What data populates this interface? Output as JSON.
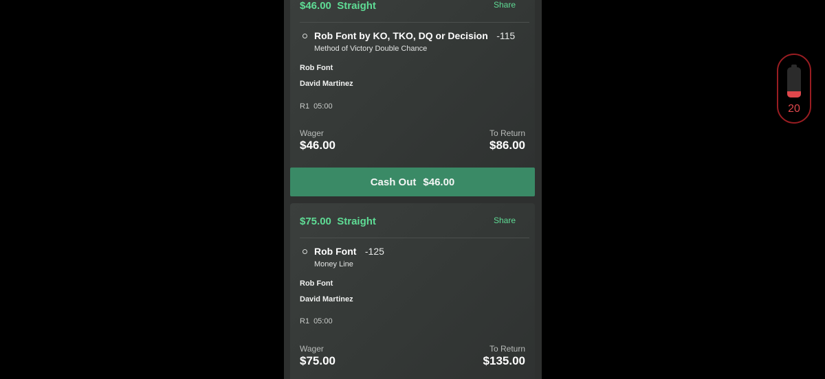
{
  "bets": [
    {
      "title_amount": "$46.00",
      "title_type": "Straight",
      "share_label": "Share",
      "selection": "Rob Font by KO, TKO, DQ or Decision",
      "odds": "-115",
      "market": "Method of Victory Double Chance",
      "fighter_1": "Rob Font",
      "fighter_2": "David Martinez",
      "round": "R1",
      "time": "05:00",
      "wager_label": "Wager",
      "wager": "$46.00",
      "return_label": "To Return",
      "to_return": "$86.00",
      "cashout_label": "Cash Out",
      "cashout_amount": "$46.00"
    },
    {
      "title_amount": "$75.00",
      "title_type": "Straight",
      "share_label": "Share",
      "selection": "Rob Font",
      "odds": "-125",
      "market": "Money Line",
      "fighter_1": "Rob Font",
      "fighter_2": "David Martinez",
      "round": "R1",
      "time": "05:00",
      "wager_label": "Wager",
      "wager": "$75.00",
      "return_label": "To Return",
      "to_return": "$135.00"
    }
  ],
  "battery": {
    "level_text": "20",
    "level_percent": 20,
    "color": "#e0474c"
  },
  "colors": {
    "accent_green": "#5fdc95",
    "cashout_bg": "#3a8a66",
    "background": "#000000"
  }
}
